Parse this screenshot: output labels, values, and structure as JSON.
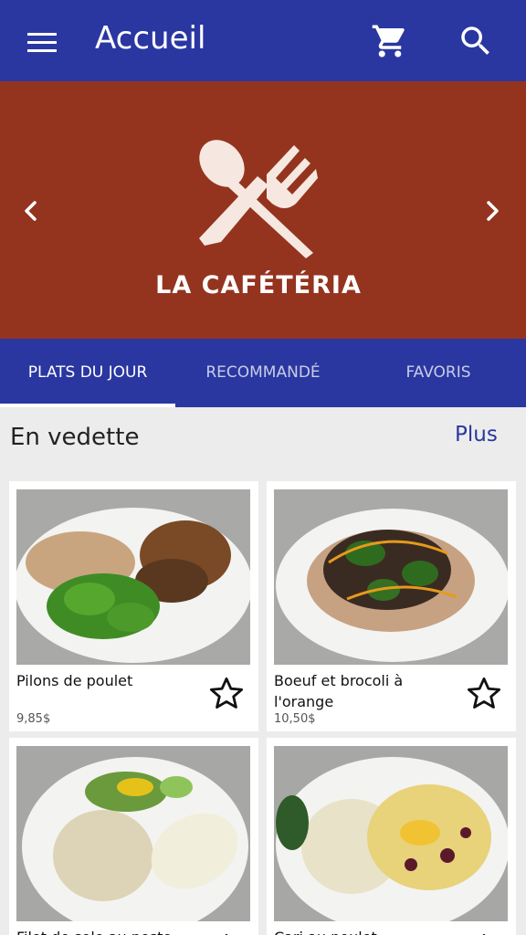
{
  "app_bar": {
    "title": "Accueil",
    "menu_icon": "hamburger-menu-icon",
    "cart_icon": "shopping-cart-icon",
    "search_icon": "search-icon",
    "color": "#2a37a1"
  },
  "banner": {
    "brand": "LA CAFÉTÉRIA",
    "logo_icon": "spoon-fork-icon",
    "background": "#94341f"
  },
  "tabs": [
    {
      "label": "PLATS DU JOUR",
      "active": true
    },
    {
      "label": "RECOMMANDÉ",
      "active": false
    },
    {
      "label": "FAVORIS",
      "active": false
    }
  ],
  "featured": {
    "title": "En vedette",
    "more_label": "Plus",
    "items": [
      {
        "name": "Pilons de poulet",
        "price": "9,85$",
        "favorite": false
      },
      {
        "name": "Boeuf et brocoli à l'orange",
        "price": "10,50$",
        "favorite": false
      },
      {
        "name": "Filet de sole au pesto",
        "price": "",
        "favorite": false
      },
      {
        "name": "Cari au poulet",
        "price": "",
        "favorite": false
      }
    ]
  }
}
